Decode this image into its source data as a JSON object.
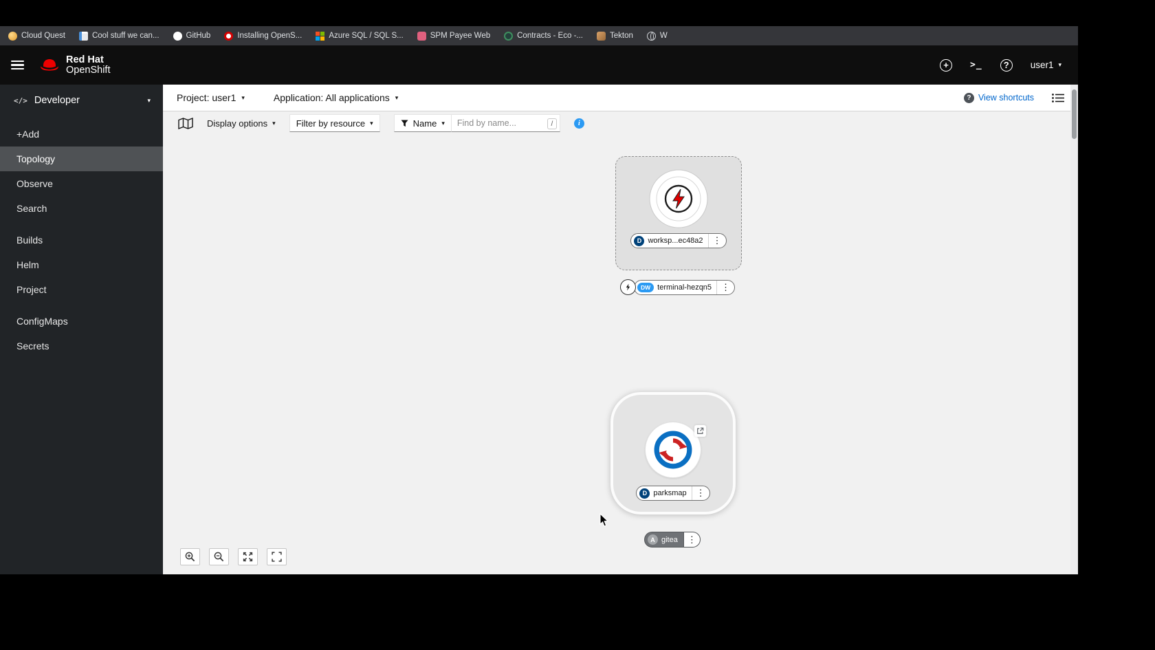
{
  "colors": {
    "brand_red": "#ee0000",
    "accent_blue": "#2b9af3",
    "link_blue": "#0066cc",
    "deployment_badge": "#00427a",
    "devworkspace_badge": "#2b9af3",
    "masthead_bg": "#0e0e0e",
    "sidebar_bg": "#212427",
    "sidebar_active_bg": "#4f5255",
    "canvas_bg": "#f1f1f1"
  },
  "browser": {
    "bookmarks": [
      {
        "label": "Cloud Quest"
      },
      {
        "label": "Cool stuff we can..."
      },
      {
        "label": "GitHub"
      },
      {
        "label": "Installing OpenS..."
      },
      {
        "label": "Azure SQL / SQL S..."
      },
      {
        "label": "SPM Payee Web"
      },
      {
        "label": "Contracts - Eco -..."
      },
      {
        "label": "Tekton"
      },
      {
        "label": "W"
      }
    ]
  },
  "masthead": {
    "brand_line1": "Red Hat",
    "brand_line2": "OpenShift",
    "username": "user1"
  },
  "sidebar": {
    "perspective": "Developer",
    "active_item": "Topology",
    "groups": [
      {
        "items": [
          "+Add",
          "Topology",
          "Observe",
          "Search"
        ]
      },
      {
        "items": [
          "Builds",
          "Helm",
          "Project"
        ]
      },
      {
        "items": [
          "ConfigMaps",
          "Secrets"
        ]
      }
    ]
  },
  "context_bar": {
    "project": "Project: user1",
    "application": "Application: All applications",
    "view_shortcuts_label": "View shortcuts"
  },
  "toolbar": {
    "display_options_label": "Display options",
    "filter_by_resource_label": "Filter by resource",
    "name_filter_label": "Name",
    "find_placeholder": "Find by name...",
    "shortcut_hint": "/"
  },
  "topology": {
    "workspace_node": {
      "badge": "D",
      "label": "worksp...ec48a2"
    },
    "terminal_node": {
      "badge": "DW",
      "label": "terminal-hezqn5"
    },
    "parksmap_node": {
      "badge": "D",
      "label": "parksmap"
    },
    "gitea_group": {
      "badge": "A",
      "label": "gitea"
    }
  },
  "icons": {
    "kebab": "⋮",
    "caret": "▾",
    "plus": "+",
    "terminal_prompt": ">_",
    "help": "?",
    "question_filled": "?",
    "info": "i",
    "code": "</>"
  }
}
